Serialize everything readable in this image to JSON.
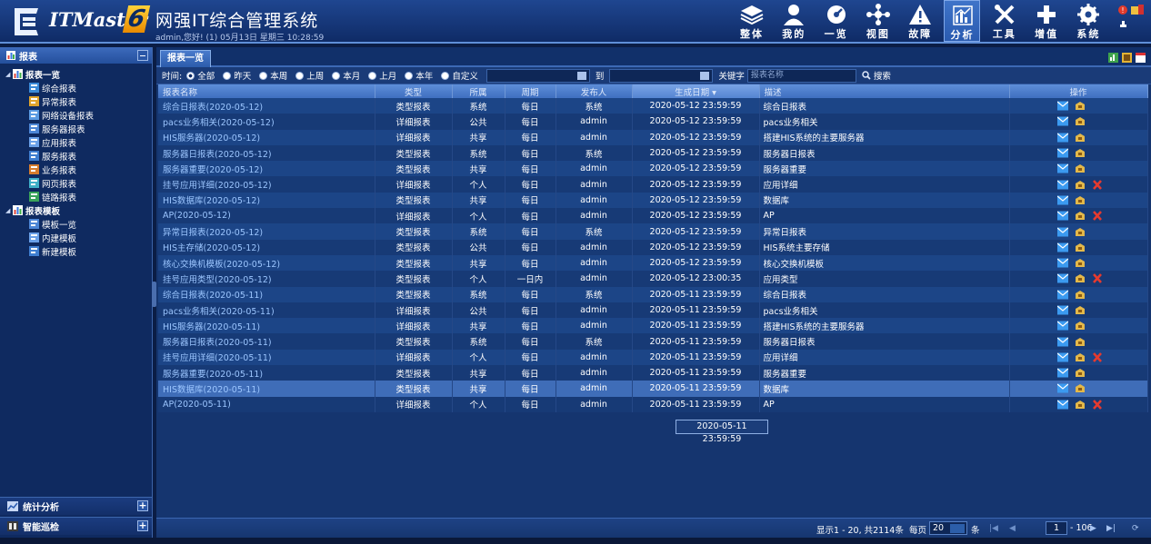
{
  "header": {
    "brand": "ITMaster",
    "version": "6",
    "title": "网强IT综合管理系统",
    "welcome": "admin,您好! (1) 05月13日 星期三 10:28:59",
    "nav": [
      {
        "label": "整体",
        "icon": "layers-icon"
      },
      {
        "label": "我的",
        "icon": "user-icon"
      },
      {
        "label": "一览",
        "icon": "dashboard-icon"
      },
      {
        "label": "视图",
        "icon": "topology-icon"
      },
      {
        "label": "故障",
        "icon": "warning-icon"
      },
      {
        "label": "分析",
        "icon": "chart-icon"
      },
      {
        "label": "工具",
        "icon": "tools-icon"
      },
      {
        "label": "增值",
        "icon": "plus-icon"
      },
      {
        "label": "系统",
        "icon": "gear-icon"
      }
    ],
    "active_nav": "分析"
  },
  "sidebar": {
    "title": "报表",
    "groups": [
      {
        "label": "报表一览",
        "items": [
          "综合报表",
          "异常报表",
          "网络设备报表",
          "服务器报表",
          "应用报表",
          "服务报表",
          "业务报表",
          "网页报表",
          "链路报表"
        ]
      },
      {
        "label": "报表模板",
        "items": [
          "模板一览",
          "内建模板",
          "新建模板"
        ]
      }
    ],
    "bottom": [
      {
        "label": "统计分析"
      },
      {
        "label": "智能巡检"
      }
    ]
  },
  "main": {
    "tab": "报表一览",
    "filter": {
      "time_label": "时间:",
      "options": [
        "全部",
        "昨天",
        "本周",
        "上周",
        "本月",
        "上月",
        "本年",
        "自定义"
      ],
      "selected": "全部",
      "to_label": "到",
      "keyword_label": "关键字",
      "keyword_placeholder": "报表名称",
      "search_label": "搜索"
    },
    "columns": [
      "报表名称",
      "类型",
      "所属",
      "周期",
      "发布人",
      "生成日期",
      "描述",
      "操作"
    ],
    "sorted_column": "生成日期",
    "rows": [
      {
        "name": "综合日报表(2020-05-12)",
        "type": "类型报表",
        "scope": "系统",
        "period": "每日",
        "publisher": "系统",
        "date": "2020-05-12 23:59:59",
        "desc": "综合日报表",
        "del": false
      },
      {
        "name": "pacs业务相关(2020-05-12)",
        "type": "详细报表",
        "scope": "公共",
        "period": "每日",
        "publisher": "admin",
        "date": "2020-05-12 23:59:59",
        "desc": "pacs业务相关",
        "del": false
      },
      {
        "name": "HIS服务器(2020-05-12)",
        "type": "详细报表",
        "scope": "共享",
        "period": "每日",
        "publisher": "admin",
        "date": "2020-05-12 23:59:59",
        "desc": "搭建HIS系统的主要服务器",
        "del": false
      },
      {
        "name": "服务器日报表(2020-05-12)",
        "type": "类型报表",
        "scope": "系统",
        "period": "每日",
        "publisher": "系统",
        "date": "2020-05-12 23:59:59",
        "desc": "服务器日报表",
        "del": false
      },
      {
        "name": "服务器重要(2020-05-12)",
        "type": "类型报表",
        "scope": "共享",
        "period": "每日",
        "publisher": "admin",
        "date": "2020-05-12 23:59:59",
        "desc": "服务器重要",
        "del": false
      },
      {
        "name": "挂号应用详细(2020-05-12)",
        "type": "详细报表",
        "scope": "个人",
        "period": "每日",
        "publisher": "admin",
        "date": "2020-05-12 23:59:59",
        "desc": "应用详细",
        "del": true
      },
      {
        "name": "HIS数据库(2020-05-12)",
        "type": "类型报表",
        "scope": "共享",
        "period": "每日",
        "publisher": "admin",
        "date": "2020-05-12 23:59:59",
        "desc": "数据库",
        "del": false
      },
      {
        "name": "AP(2020-05-12)",
        "type": "详细报表",
        "scope": "个人",
        "period": "每日",
        "publisher": "admin",
        "date": "2020-05-12 23:59:59",
        "desc": "AP",
        "del": true
      },
      {
        "name": "异常日报表(2020-05-12)",
        "type": "类型报表",
        "scope": "系统",
        "period": "每日",
        "publisher": "系统",
        "date": "2020-05-12 23:59:59",
        "desc": "异常日报表",
        "del": false
      },
      {
        "name": "HIS主存储(2020-05-12)",
        "type": "类型报表",
        "scope": "公共",
        "period": "每日",
        "publisher": "admin",
        "date": "2020-05-12 23:59:59",
        "desc": "HIS系统主要存储",
        "del": false
      },
      {
        "name": "核心交换机模板(2020-05-12)",
        "type": "类型报表",
        "scope": "共享",
        "period": "每日",
        "publisher": "admin",
        "date": "2020-05-12 23:59:59",
        "desc": "核心交换机模板",
        "del": false
      },
      {
        "name": "挂号应用类型(2020-05-12)",
        "type": "类型报表",
        "scope": "个人",
        "period": "一日内",
        "publisher": "admin",
        "date": "2020-05-12 23:00:35",
        "desc": "应用类型",
        "del": true
      },
      {
        "name": "综合日报表(2020-05-11)",
        "type": "类型报表",
        "scope": "系统",
        "period": "每日",
        "publisher": "系统",
        "date": "2020-05-11 23:59:59",
        "desc": "综合日报表",
        "del": false
      },
      {
        "name": "pacs业务相关(2020-05-11)",
        "type": "详细报表",
        "scope": "公共",
        "period": "每日",
        "publisher": "admin",
        "date": "2020-05-11 23:59:59",
        "desc": "pacs业务相关",
        "del": false
      },
      {
        "name": "HIS服务器(2020-05-11)",
        "type": "详细报表",
        "scope": "共享",
        "period": "每日",
        "publisher": "admin",
        "date": "2020-05-11 23:59:59",
        "desc": "搭建HIS系统的主要服务器",
        "del": false
      },
      {
        "name": "服务器日报表(2020-05-11)",
        "type": "类型报表",
        "scope": "系统",
        "period": "每日",
        "publisher": "系统",
        "date": "2020-05-11 23:59:59",
        "desc": "服务器日报表",
        "del": false
      },
      {
        "name": "挂号应用详细(2020-05-11)",
        "type": "详细报表",
        "scope": "个人",
        "period": "每日",
        "publisher": "admin",
        "date": "2020-05-11 23:59:59",
        "desc": "应用详细",
        "del": true
      },
      {
        "name": "服务器重要(2020-05-11)",
        "type": "类型报表",
        "scope": "共享",
        "period": "每日",
        "publisher": "admin",
        "date": "2020-05-11 23:59:59",
        "desc": "服务器重要",
        "del": false
      },
      {
        "name": "HIS数据库(2020-05-11)",
        "type": "类型报表",
        "scope": "共享",
        "period": "每日",
        "publisher": "admin",
        "date": "2020-05-11 23:59:59",
        "desc": "数据库",
        "del": false,
        "highlighted": true
      },
      {
        "name": "AP(2020-05-11)",
        "type": "详细报表",
        "scope": "个人",
        "period": "每日",
        "publisher": "admin",
        "date": "2020-05-11 23:59:59",
        "desc": "AP",
        "del": true
      }
    ],
    "tooltip": "2020-05-11 23:59:59"
  },
  "pager": {
    "info": "显示1 - 20, 共2114条",
    "per_page_label": "每页",
    "per_page": "20",
    "unit": "条",
    "page": "1",
    "total_pages": "- 106"
  }
}
